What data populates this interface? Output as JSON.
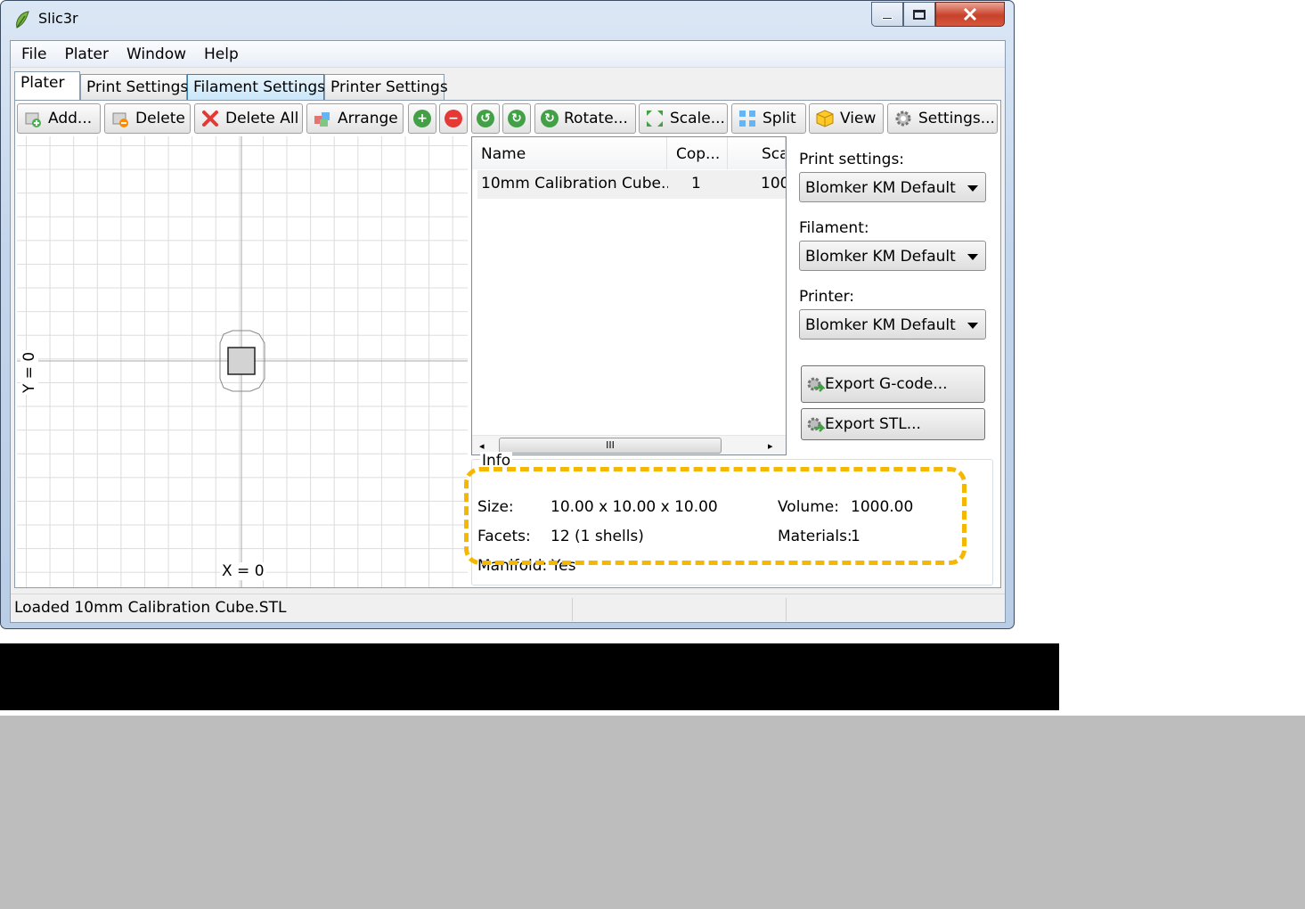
{
  "window": {
    "title": "Slic3r"
  },
  "menu": [
    "File",
    "Plater",
    "Window",
    "Help"
  ],
  "tabs": [
    {
      "label": "Plater",
      "active": true
    },
    {
      "label": "Print Settings"
    },
    {
      "label": "Filament Settings",
      "hover": true
    },
    {
      "label": "Printer Settings"
    }
  ],
  "toolbar": {
    "add": "Add...",
    "delete": "Delete",
    "delete_all": "Delete All",
    "arrange": "Arrange",
    "rotate": "Rotate...",
    "scale": "Scale...",
    "split": "Split",
    "view": "View",
    "settings": "Settings..."
  },
  "plate": {
    "x_label": "X = 0",
    "y_label": "Y = 0"
  },
  "object_list": {
    "columns": [
      "Name",
      "Cop...",
      "Sca"
    ],
    "rows": [
      {
        "name": "10mm Calibration Cube...",
        "copies": "1",
        "scale": "100"
      }
    ],
    "scroll_grip": "III"
  },
  "right_panel": {
    "print_settings_label": "Print settings:",
    "print_settings_value": "Blomker KM Default",
    "filament_label": "Filament:",
    "filament_value": "Blomker KM Default",
    "printer_label": "Printer:",
    "printer_value": "Blomker KM Default",
    "export_gcode": "Export G-code...",
    "export_stl": "Export STL..."
  },
  "info": {
    "title": "Info",
    "size_label": "Size:",
    "size_value": "10.00 x 10.00 x 10.00",
    "volume_label": "Volume:",
    "volume_value": "1000.00",
    "facets_label": "Facets:",
    "facets_value": "12 (1 shells)",
    "materials_label": "Materials:",
    "materials_value": "1",
    "manifold_label": "Manifold:",
    "manifold_value": "Yes"
  },
  "status": {
    "message": "Loaded 10mm Calibration Cube.STL"
  },
  "colors": {
    "highlight": "#f5b800",
    "accent_blue": "#3c7fb1",
    "close_red": "#c9412a"
  }
}
